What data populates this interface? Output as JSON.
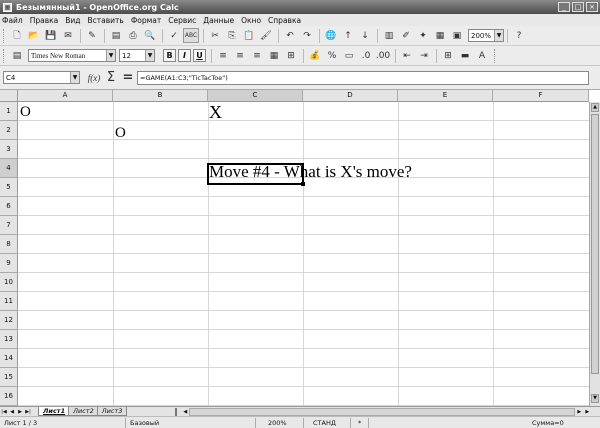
{
  "window": {
    "title": "Безымянный1 - OpenOffice.org Calc"
  },
  "menu": [
    "Файл",
    "Правка",
    "Вид",
    "Вставить",
    "Формат",
    "Сервис",
    "Данные",
    "Окно",
    "Справка"
  ],
  "toolbar": {
    "zoom": "200%"
  },
  "formatting": {
    "font_name": "Times New Roman",
    "font_size": "12",
    "bold": "B",
    "italic": "I",
    "underline": "U"
  },
  "formula_bar": {
    "cell_ref": "C4",
    "formula": "=GAME(A1:C3;\"TicTacToe\")"
  },
  "columns": [
    "A",
    "B",
    "C",
    "D",
    "E",
    "F"
  ],
  "selected_column": "C",
  "rows": [
    "1",
    "2",
    "3",
    "4",
    "5",
    "6",
    "7",
    "8",
    "9",
    "10",
    "11",
    "12",
    "13",
    "14",
    "15",
    "16"
  ],
  "selected_row": "4",
  "cells": {
    "a1": "O",
    "b2": "O",
    "c1": "X",
    "c4": "Move #4 - What is X's move?"
  },
  "sheet_tabs": [
    "Лист1",
    "Лист2",
    "Лист3"
  ],
  "active_sheet": "Лист1",
  "status": {
    "sheet": "Лист 1 / 3",
    "style": "Базовый",
    "zoom": "200%",
    "mode": "СТАНД",
    "modified": "*",
    "sum": "Сумма=0"
  }
}
